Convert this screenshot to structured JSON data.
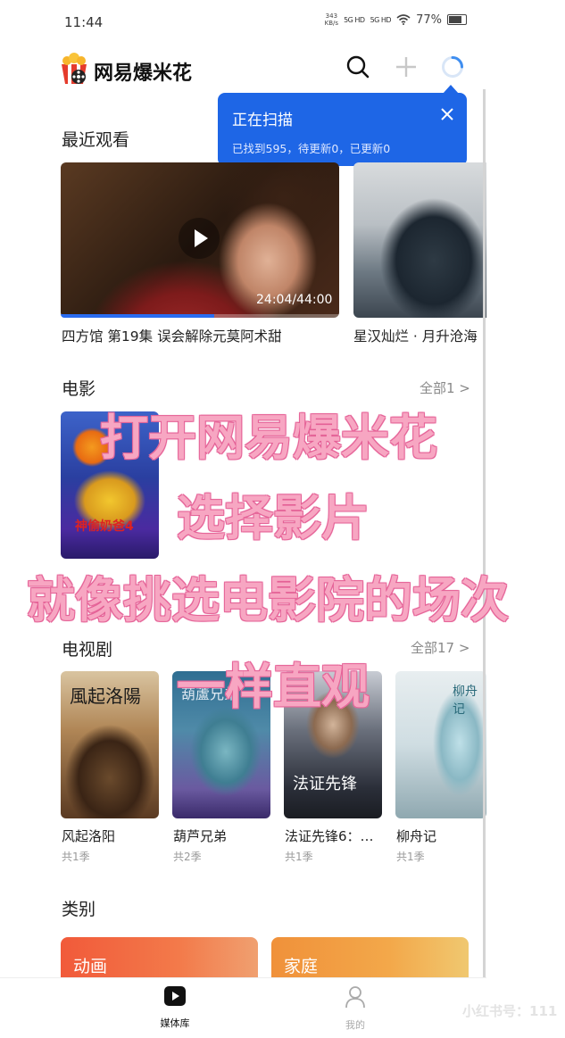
{
  "status_bar": {
    "time": "11:44",
    "net_speed": "343",
    "net_unit": "KB/s",
    "signal1": "5G HD",
    "signal2": "5G HD",
    "battery": "77%"
  },
  "header": {
    "app_name": "网易爆米花"
  },
  "scan_toast": {
    "title": "正在扫描",
    "info": "已找到595，待更新0，已更新0"
  },
  "recent": {
    "title": "最近观看",
    "items": [
      {
        "title": "四方馆 第19集 误会解除元莫阿术甜",
        "duration": "24:04/44:00",
        "progress": 0.55
      },
      {
        "title": "星汉灿烂 · 月升沧海"
      }
    ]
  },
  "movies": {
    "title": "电影",
    "more": "全部1 >",
    "items": [
      {
        "poster_text": "神偷奶爸4"
      }
    ]
  },
  "tv": {
    "title": "电视剧",
    "more": "全部17 >",
    "items": [
      {
        "title": "风起洛阳",
        "seasons": "共1季",
        "poster_text": "風起洛陽"
      },
      {
        "title": "葫芦兄弟",
        "seasons": "共2季",
        "poster_text": "葫蘆兄弟"
      },
      {
        "title": "法证先锋6：…",
        "seasons": "共1季",
        "poster_text": "法证先锋"
      },
      {
        "title": "柳舟记",
        "seasons": "共1季",
        "poster_text": "柳舟记"
      }
    ]
  },
  "categories": {
    "title": "类别",
    "items": [
      {
        "label": "动画"
      },
      {
        "label": "家庭"
      }
    ]
  },
  "bottom_nav": {
    "media_library": "媒体库",
    "mine": "我的"
  },
  "overlay": {
    "line1": "打开网易爆米花",
    "line2": "选择影片",
    "line3": "就像挑选电影院的场次",
    "line4": "一样直观"
  },
  "watermark": "小红书号：111",
  "colors": {
    "accent": "#1e66e6",
    "overlay_text": "#f7a6c2",
    "category_animation": "#f15a3a",
    "category_family": "#f0913a"
  }
}
